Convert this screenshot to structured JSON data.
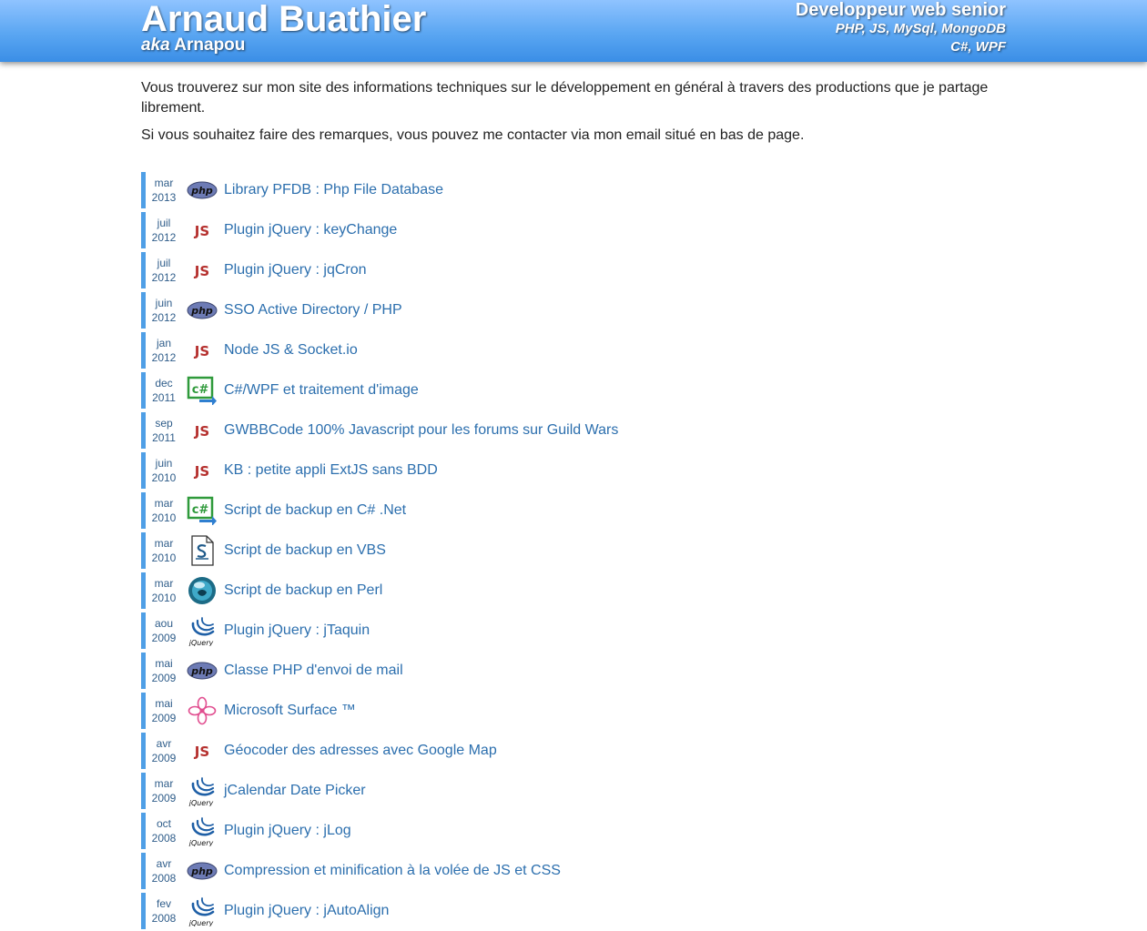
{
  "header": {
    "name": "Arnaud Buathier",
    "aka_prefix": "aka",
    "aka_name": "Arnapou",
    "role_title": "Developpeur web senior",
    "role_line1": "PHP, JS, MySql, MongoDB",
    "role_line2": "C#, WPF"
  },
  "intro": {
    "p1": "Vous trouverez sur mon site des informations techniques sur le développement en général à travers des productions que je partage librement.",
    "p2": "Si vous souhaitez faire des remarques, vous pouvez me contacter via mon email situé en bas de page."
  },
  "colors": {
    "header_top": "#8fc3ff",
    "header_bottom": "#3a8ee6",
    "date_bar": "#4f9fe6",
    "link": "#2c6fae"
  },
  "items": [
    {
      "month": "mar",
      "year": "2013",
      "icon": "php-icon",
      "title": "Library PFDB : Php File Database"
    },
    {
      "month": "juil",
      "year": "2012",
      "icon": "js-icon",
      "title": "Plugin jQuery : keyChange"
    },
    {
      "month": "juil",
      "year": "2012",
      "icon": "js-icon",
      "title": "Plugin jQuery : jqCron"
    },
    {
      "month": "juin",
      "year": "2012",
      "icon": "php-icon",
      "title": "SSO Active Directory / PHP"
    },
    {
      "month": "jan",
      "year": "2012",
      "icon": "js-icon",
      "title": "Node JS & Socket.io"
    },
    {
      "month": "dec",
      "year": "2011",
      "icon": "csharp-icon",
      "title": "C#/WPF et traitement d'image"
    },
    {
      "month": "sep",
      "year": "2011",
      "icon": "js-icon",
      "title": "GWBBCode 100% Javascript pour les forums sur Guild Wars"
    },
    {
      "month": "juin",
      "year": "2010",
      "icon": "js-icon",
      "title": "KB : petite appli ExtJS sans BDD"
    },
    {
      "month": "mar",
      "year": "2010",
      "icon": "csharp-icon",
      "title": "Script de backup en C# .Net"
    },
    {
      "month": "mar",
      "year": "2010",
      "icon": "vbs-icon",
      "title": "Script de backup en VBS"
    },
    {
      "month": "mar",
      "year": "2010",
      "icon": "perl-icon",
      "title": "Script de backup en Perl"
    },
    {
      "month": "aou",
      "year": "2009",
      "icon": "jquery-icon",
      "title": "Plugin jQuery : jTaquin"
    },
    {
      "month": "mai",
      "year": "2009",
      "icon": "php-icon",
      "title": "Classe PHP d'envoi de mail"
    },
    {
      "month": "mai",
      "year": "2009",
      "icon": "surface-icon",
      "title": "Microsoft Surface ™"
    },
    {
      "month": "avr",
      "year": "2009",
      "icon": "js-icon",
      "title": "Géocoder des adresses avec Google Map"
    },
    {
      "month": "mar",
      "year": "2009",
      "icon": "jquery-icon",
      "title": "jCalendar Date Picker"
    },
    {
      "month": "oct",
      "year": "2008",
      "icon": "jquery-icon",
      "title": "Plugin jQuery : jLog"
    },
    {
      "month": "avr",
      "year": "2008",
      "icon": "php-icon",
      "title": "Compression et minification à la volée de JS et CSS"
    },
    {
      "month": "fev",
      "year": "2008",
      "icon": "jquery-icon",
      "title": "Plugin jQuery : jAutoAlign"
    }
  ]
}
